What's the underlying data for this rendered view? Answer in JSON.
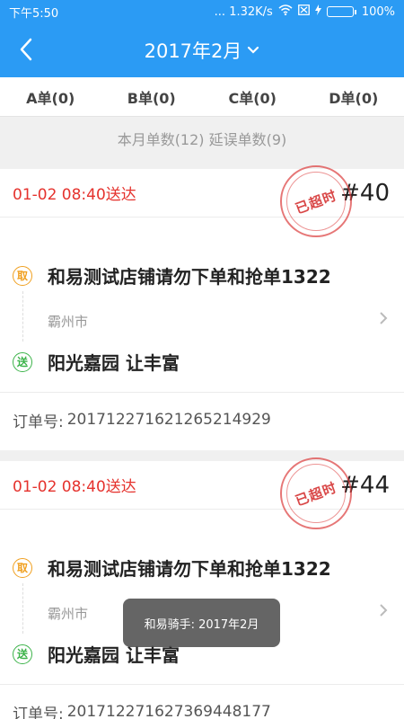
{
  "status_bar": {
    "time": "下午5:50",
    "network": "... 1.32K/s",
    "battery": "100%",
    "battery_level": 1.0
  },
  "header": {
    "title": "2017年2月"
  },
  "tabs": [
    {
      "label": "A单(0)"
    },
    {
      "label": "B单(0)"
    },
    {
      "label": "C单(0)"
    },
    {
      "label": "D单(0)"
    }
  ],
  "summary": "本月单数(12) 延误单数(9)",
  "orders": [
    {
      "deliver_time": "01-02 08:40送达",
      "stamp": "已超时",
      "number": "#40",
      "pick_badge": "取",
      "shop_name": "和易测试店铺请勿下单和抢单1322",
      "city": "霸州市",
      "drop_badge": "送",
      "customer": "阳光嘉园 让丰富",
      "order_no_label": "订单号:",
      "order_no": "20171227162126521492​9"
    },
    {
      "deliver_time": "01-02 08:40送达",
      "stamp": "已超时",
      "number": "#44",
      "pick_badge": "取",
      "shop_name": "和易测试店铺请勿下单和抢单1322",
      "city": "霸州市",
      "drop_badge": "送",
      "customer": "阳光嘉园 让丰富",
      "order_no_label": "订单号:",
      "order_no": "20171227162736944817​7"
    }
  ],
  "toast": "和易骑手: 2017年2月"
}
